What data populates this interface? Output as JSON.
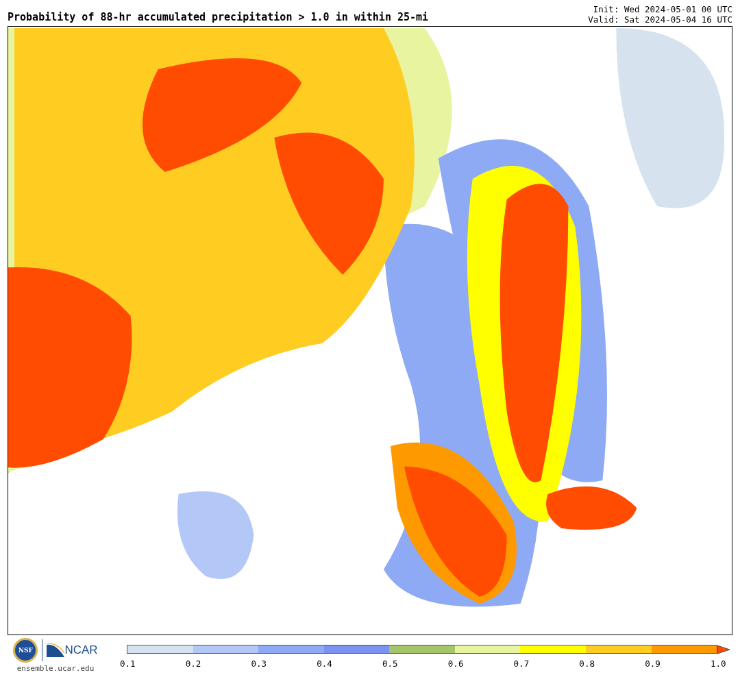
{
  "title": "Probability of 88-hr accumulated precipitation > 1.0 in within 25-mi",
  "init": "Init: Wed 2024-05-01 00 UTC",
  "valid": "Valid: Sat 2024-05-04 16 UTC",
  "logos": {
    "nsf": "NSF",
    "ncar": "NCAR",
    "site": "ensemble.ucar.edu"
  },
  "legend": {
    "bins": [
      {
        "color": "#d6e2ee"
      },
      {
        "color": "#b4c8f8"
      },
      {
        "color": "#8eaaf5"
      },
      {
        "color": "#7a92f0"
      },
      {
        "color": "#a4c66a"
      },
      {
        "color": "#e8f4a0"
      },
      {
        "color": "#ffff00"
      },
      {
        "color": "#ffcc22"
      },
      {
        "color": "#ff9900"
      }
    ],
    "extension": {
      "kind": "arrow",
      "color": "#ff4c00"
    },
    "ticks": [
      "0.1",
      "0.2",
      "0.3",
      "0.4",
      "0.5",
      "0.6",
      "0.7",
      "0.8",
      "0.9",
      "1.0"
    ]
  }
}
